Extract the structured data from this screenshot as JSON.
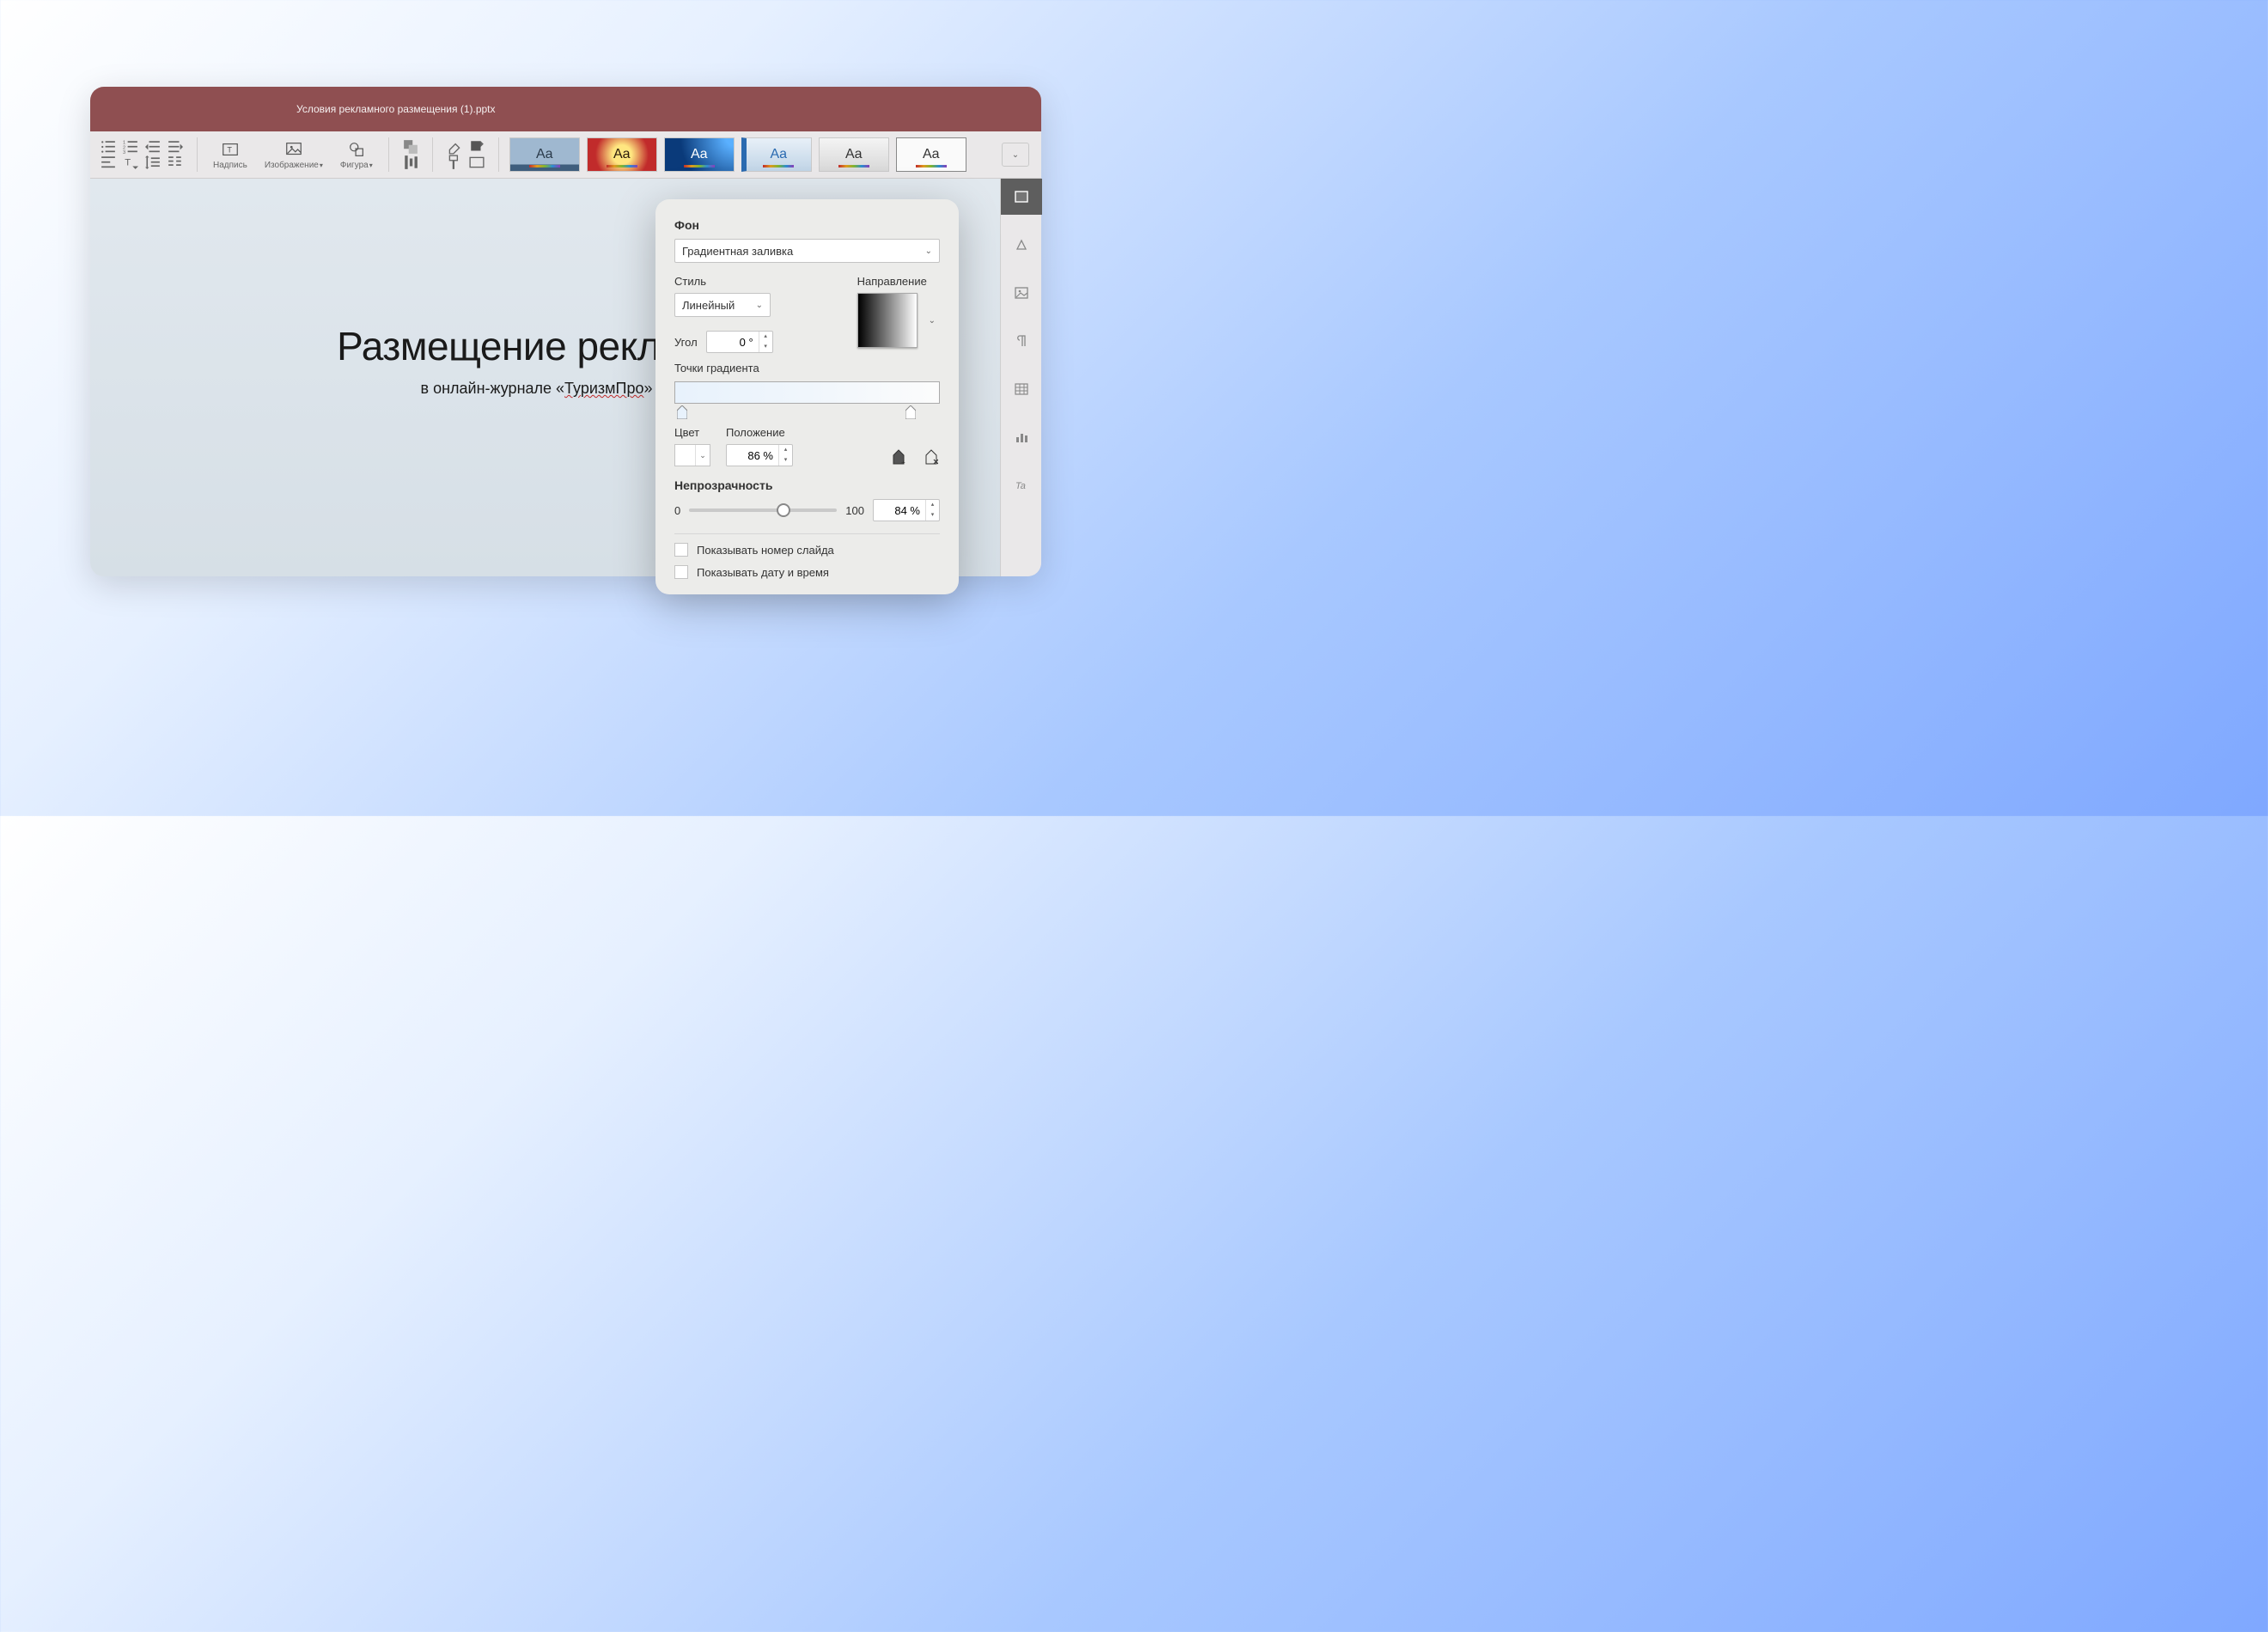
{
  "window": {
    "title": "Условия рекламного размещения (1).pptx"
  },
  "toolbar": {
    "textbox_label": "Надпись",
    "image_label": "Изображение",
    "shape_label": "Фигура",
    "themes": [
      {
        "name": "theme-aqua"
      },
      {
        "name": "theme-golden"
      },
      {
        "name": "theme-deep-blue"
      },
      {
        "name": "theme-light-blue"
      },
      {
        "name": "theme-gray"
      },
      {
        "name": "theme-blank"
      }
    ]
  },
  "slide": {
    "title": "Размещение рекламы",
    "subtitle_prefix": "в онлайн-журнале «",
    "subtitle_underlined": "ТуризмПро",
    "subtitle_suffix": "»"
  },
  "panel": {
    "heading": "Фон",
    "fill_type": "Градиентная заливка",
    "style_label": "Стиль",
    "style_value": "Линейный",
    "direction_label": "Направление",
    "angle_label": "Угол",
    "angle_value": "0 °",
    "stops_label": "Точки градиента",
    "gradient_stops": [
      {
        "position_pct": 3,
        "color": "#e8f2fc"
      },
      {
        "position_pct": 89,
        "color": "#ffffff"
      }
    ],
    "color_label": "Цвет",
    "position_label": "Положение",
    "position_value": "86 %",
    "opacity_label": "Непрозрачность",
    "opacity_min": "0",
    "opacity_max": "100",
    "opacity_slider_pct": 64,
    "opacity_value": "84 %",
    "show_slide_number_label": "Показывать номер слайда",
    "show_datetime_label": "Показывать дату и время"
  }
}
